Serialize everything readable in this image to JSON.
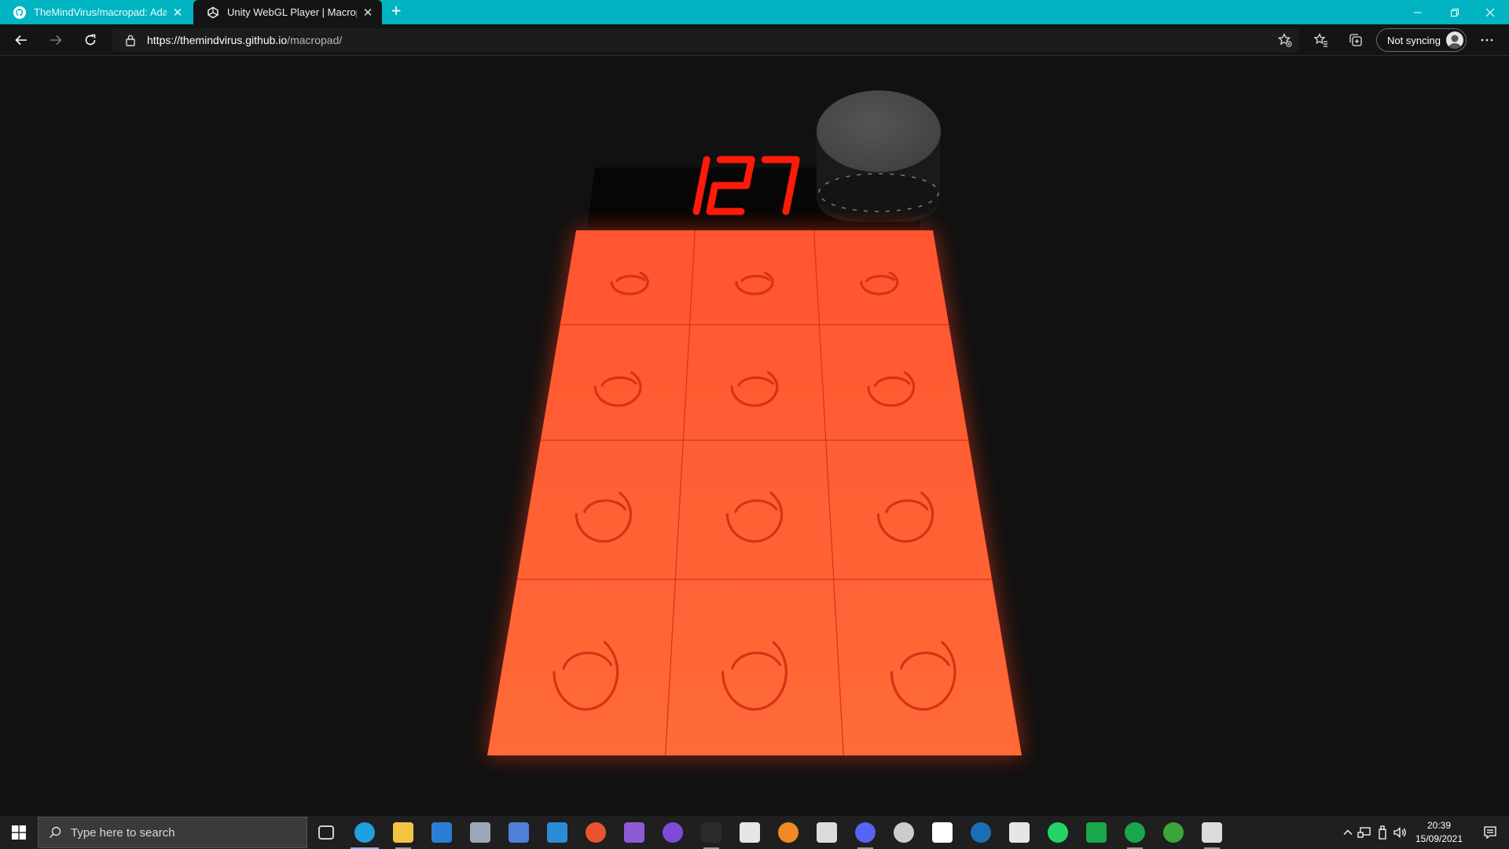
{
  "browser": {
    "tabs": [
      {
        "title": "TheMindVirus/macropad: Adafr",
        "favicon": "github-icon",
        "active": false
      },
      {
        "title": "Unity WebGL Player | Macropad",
        "favicon": "unity-icon",
        "active": true
      }
    ],
    "url": {
      "domain": "https://themindvirus.github.io",
      "path": "/macropad/"
    },
    "sync_label": "Not syncing",
    "colors": {
      "titlebar": "#00b4c2",
      "toolbar": "#141414"
    }
  },
  "app": {
    "display_value": "127",
    "key_grid": {
      "rows": 4,
      "cols": 3
    },
    "colors": {
      "key_glow": "#ff5a2a",
      "display_digits": "#ff1a0a",
      "knob": "#4a4a4a",
      "background": "#111111"
    }
  },
  "taskbar": {
    "search_placeholder": "Type here to search",
    "apps": [
      {
        "name": "task-view",
        "color": "#d0d0d0"
      },
      {
        "name": "edge",
        "color": "#1fa0e0",
        "state": "active"
      },
      {
        "name": "file-explorer",
        "color": "#f4c542",
        "state": "running"
      },
      {
        "name": "store",
        "color": "#2b7ed6"
      },
      {
        "name": "mail",
        "color": "#9aa8b8"
      },
      {
        "name": "network-tool",
        "color": "#4f7fd6"
      },
      {
        "name": "vscode",
        "color": "#2a8bd6"
      },
      {
        "name": "git-tool",
        "color": "#e8542c"
      },
      {
        "name": "visual-studio",
        "color": "#8e5bd6"
      },
      {
        "name": "github-desktop",
        "color": "#7d4bd6"
      },
      {
        "name": "terminal",
        "color": "#2a2a2a",
        "state": "running"
      },
      {
        "name": "excel",
        "color": "#e6e6e6"
      },
      {
        "name": "blender",
        "color": "#f08a24"
      },
      {
        "name": "documents",
        "color": "#dcdcdc"
      },
      {
        "name": "discord",
        "color": "#5865f2",
        "state": "running"
      },
      {
        "name": "obs",
        "color": "#cccccc"
      },
      {
        "name": "settings-tool",
        "color": "#ffffff"
      },
      {
        "name": "steam",
        "color": "#1b6fb5"
      },
      {
        "name": "unity",
        "color": "#e6e6e6"
      },
      {
        "name": "whatsapp",
        "color": "#25d366"
      },
      {
        "name": "chat",
        "color": "#1aa64a"
      },
      {
        "name": "hangouts",
        "color": "#1aa64a",
        "state": "running"
      },
      {
        "name": "xbox",
        "color": "#3aa63a"
      },
      {
        "name": "remote-desktop",
        "color": "#dcdcdc",
        "state": "running"
      }
    ],
    "clock": {
      "time": "20:39",
      "date": "15/09/2021"
    }
  }
}
